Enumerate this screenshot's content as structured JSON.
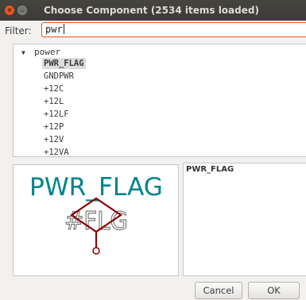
{
  "window": {
    "title": "Choose Component (2534 items loaded)",
    "close_glyph": "×",
    "min_glyph": "–"
  },
  "filter": {
    "label": "Filter:",
    "value": "pwr"
  },
  "tree": {
    "group_arrow": "▼",
    "group": "power",
    "items": [
      "PWR_FLAG",
      "GNDPWR",
      "+12C",
      "+12L",
      "+12LF",
      "+12P",
      "+12V",
      "+12VA"
    ],
    "selected_index": 0
  },
  "preview": {
    "symbol_value": "PWR_FLAG",
    "symbol_ref": "#FLG"
  },
  "description": {
    "title": "PWR_FLAG"
  },
  "buttons": {
    "cancel": "Cancel",
    "ok": "OK"
  },
  "colors": {
    "accent": "#e95420",
    "symbol_text": "#00848c",
    "symbol_body": "#8b0000",
    "ref_text": "#7a7a7a"
  }
}
